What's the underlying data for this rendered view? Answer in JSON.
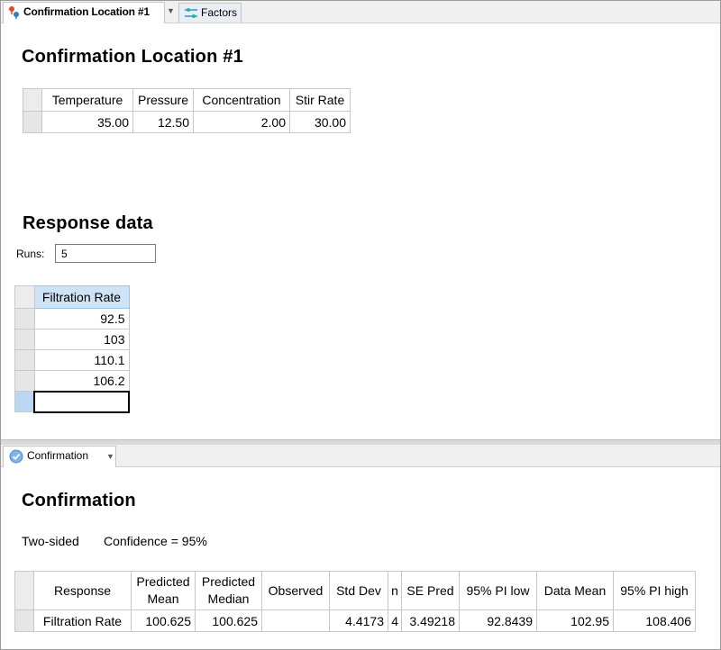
{
  "tabs_top": [
    {
      "label": "Confirmation Location #1",
      "icon": "pin-icon"
    },
    {
      "label": "Factors",
      "icon": "sliders-icon"
    }
  ],
  "location": {
    "title": "Confirmation Location #1",
    "headers": [
      "Temperature",
      "Pressure",
      "Concentration",
      "Stir Rate"
    ],
    "values": [
      "35.00",
      "12.50",
      "2.00",
      "30.00"
    ]
  },
  "response": {
    "title": "Response data",
    "runs_label": "Runs:",
    "runs_value": "5",
    "column": "Filtration Rate",
    "values": [
      "92.5",
      "103",
      "110.1",
      "106.2",
      ""
    ]
  },
  "tabs_bottom": [
    {
      "label": "Confirmation",
      "icon": "check-circle-icon"
    }
  ],
  "confirmation": {
    "title": "Confirmation",
    "sided": "Two-sided",
    "confidence": "Confidence = 95%",
    "headers": [
      "Response",
      "Predicted Mean",
      "Predicted Median",
      "Observed",
      "Std Dev",
      "n",
      "SE Pred",
      "95% PI low",
      "Data Mean",
      "95% PI high"
    ],
    "row": [
      "Filtration Rate",
      "100.625",
      "100.625",
      "",
      "4.4173",
      "4",
      "3.49218",
      "92.8439",
      "102.95",
      "108.406"
    ]
  },
  "colors": {
    "selection": "#bcd7f3",
    "tab_bg": "#f0f0f0",
    "header_border": "#c8c8c8"
  }
}
